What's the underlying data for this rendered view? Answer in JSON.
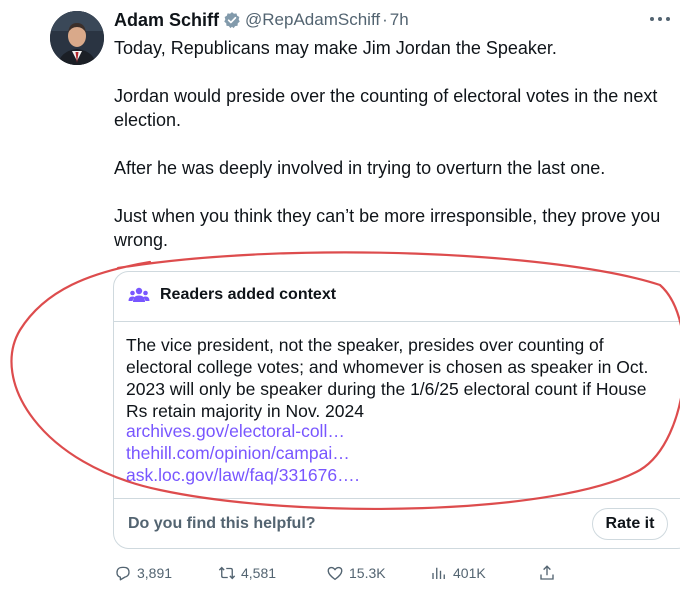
{
  "author": {
    "name": "Adam Schiff",
    "handle": "@RepAdamSchiff",
    "separator": "·",
    "time": "7h"
  },
  "tweet": {
    "paragraphs": [
      "Today, Republicans may make Jim Jordan the Speaker.",
      "Jordan would preside over the counting of electoral votes in the next election.",
      "After he was deeply involved in trying to overturn the last one.",
      "Just when you think they can’t be more irresponsible, they prove you wrong."
    ]
  },
  "context": {
    "title": "Readers added context",
    "body": "The vice president, not the speaker, presides over counting of electoral college votes; and whomever is chosen as speaker in Oct. 2023 will only be speaker during the 1/6/25 electoral count if House Rs retain majority in Nov. 2024",
    "links": [
      "archives.gov/electoral-coll…",
      "thehill.com/opinion/campai…",
      "ask.loc.gov/law/faq/331676…."
    ],
    "helpful_prompt": "Do you find this helpful?",
    "rate_label": "Rate it"
  },
  "actions": {
    "replies": "3,891",
    "reposts": "4,581",
    "likes": "15.3K",
    "views": "401K"
  },
  "icons": {
    "verified": "verified-badge-icon",
    "more": "more-options-icon",
    "context": "people-icon",
    "reply": "reply-icon",
    "repost": "repost-icon",
    "like": "heart-icon",
    "views": "views-icon",
    "share": "share-icon"
  },
  "colors": {
    "text": "#0f1419",
    "secondary": "#536471",
    "link": "#7856ff",
    "border": "#cfd9de",
    "annotation": "#d9383a"
  }
}
